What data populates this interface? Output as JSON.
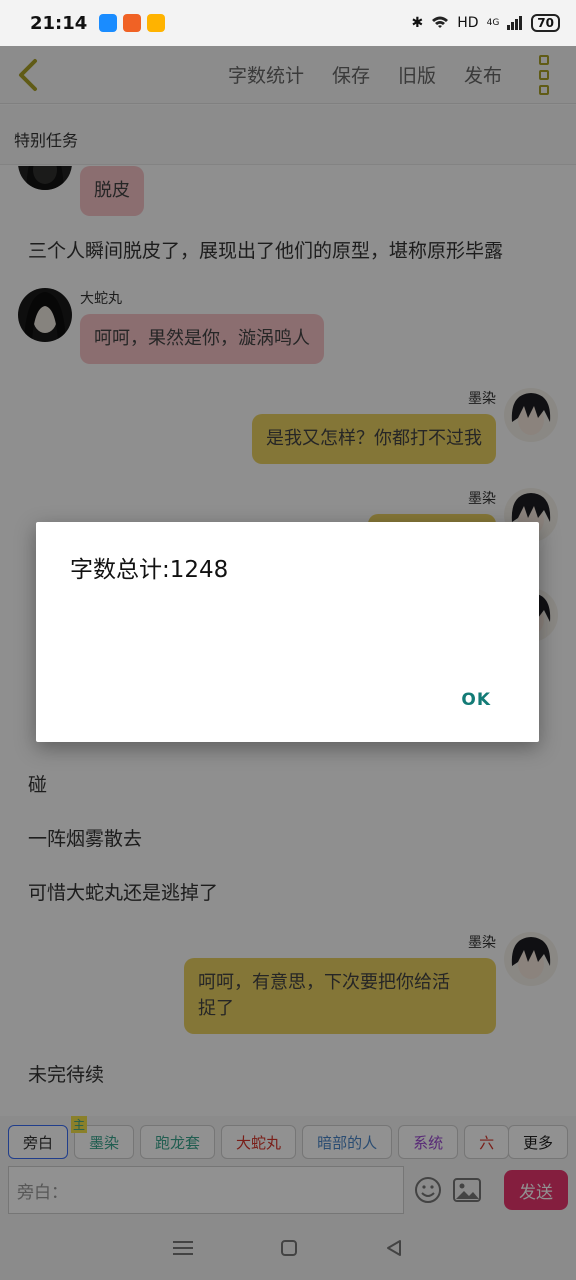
{
  "status_bar": {
    "time": "21:14",
    "network": "HD",
    "signal": "4G",
    "battery": "70"
  },
  "header": {
    "actions": [
      "字数统计",
      "保存",
      "旧版",
      "发布"
    ]
  },
  "subtitle": "特别任务",
  "messages": [
    {
      "type": "bubble",
      "side": "left",
      "text": "脱皮"
    },
    {
      "type": "narration",
      "text": "三个人瞬间脱皮了，展现出了他们的原型，堪称原形毕露"
    },
    {
      "type": "bubble",
      "side": "left",
      "sender": "大蛇丸",
      "text": "呵呵，果然是你，漩涡鸣人"
    },
    {
      "type": "bubble",
      "side": "right",
      "sender": "墨染",
      "text": "是我又怎样？你都打不过我"
    },
    {
      "type": "bubble",
      "side": "right",
      "sender": "墨染",
      "text": ""
    },
    {
      "type": "narration",
      "text": "碰"
    },
    {
      "type": "narration",
      "text": "一阵烟雾散去"
    },
    {
      "type": "narration",
      "text": "可惜大蛇丸还是逃掉了"
    },
    {
      "type": "bubble",
      "side": "right",
      "sender": "墨染",
      "text_lines": [
        "呵呵，有意思，下次要把你给活",
        "捉了"
      ]
    },
    {
      "type": "narration",
      "text": "未完待续"
    }
  ],
  "chips": [
    {
      "label": "旁白",
      "active": true,
      "color": "#333333"
    },
    {
      "label": "墨染",
      "tag": "主",
      "color": "#3aa58f"
    },
    {
      "label": "跑龙套",
      "color": "#3aa58f"
    },
    {
      "label": "大蛇丸",
      "color": "#d6362b"
    },
    {
      "label": "暗部的人",
      "color": "#4a86c8"
    },
    {
      "label": "系统",
      "color": "#9c4bd1"
    },
    {
      "label": "六",
      "color": "#d6362b"
    }
  ],
  "more_label": "更多",
  "composer": {
    "placeholder": "旁白：",
    "send_label": "发送"
  },
  "dialog": {
    "message": "字数总计:1248",
    "ok_label": "OK"
  }
}
